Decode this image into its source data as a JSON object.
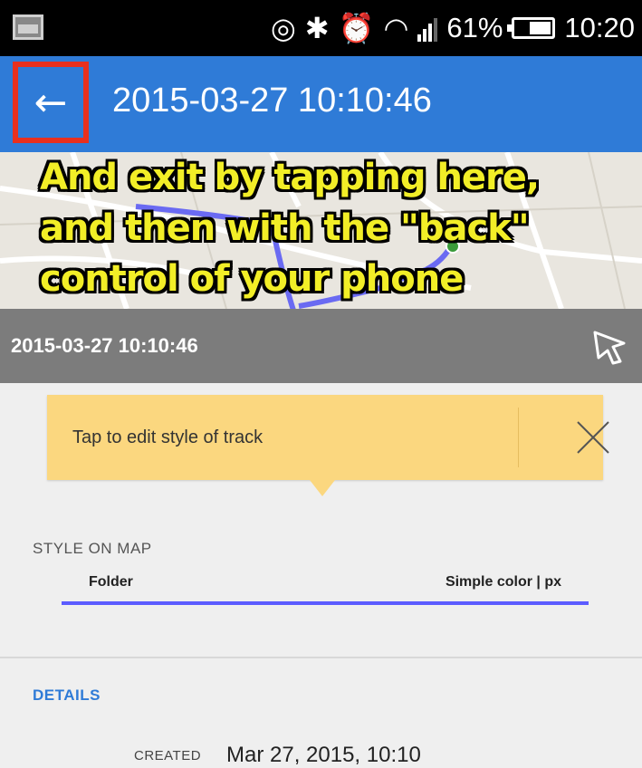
{
  "status_bar": {
    "battery_percent_text": "61%",
    "battery_level": 0.61,
    "time": "10:20",
    "icons": [
      "notification-icon",
      "nfc-icon",
      "bluetooth-icon",
      "alarm-icon",
      "wifi-icon",
      "signal-icon",
      "battery-icon"
    ]
  },
  "app_bar": {
    "back_icon": "arrow-left-icon",
    "title": "2015-03-27 10:10:46",
    "color": "#2f7bd7"
  },
  "annotation": {
    "lines": [
      "And exit by tapping here,",
      "and then with the \"back\"",
      "control of your phone"
    ],
    "highlight_color": "#e8301e",
    "text_color": "#f2ee27"
  },
  "track_header": {
    "title": "2015-03-27 10:10:46",
    "share_icon": "share-icon"
  },
  "tooltip": {
    "text": "Tap to edit style of track",
    "close_icon": "close-icon"
  },
  "style_section": {
    "label": "STYLE ON MAP",
    "folder_label": "Folder",
    "style_value": "Simple color | px",
    "line_color": "#5c5cff"
  },
  "details_section": {
    "label": "DETAILS",
    "created_label": "CREATED",
    "created_value": "Mar 27, 2015, 10:10"
  }
}
